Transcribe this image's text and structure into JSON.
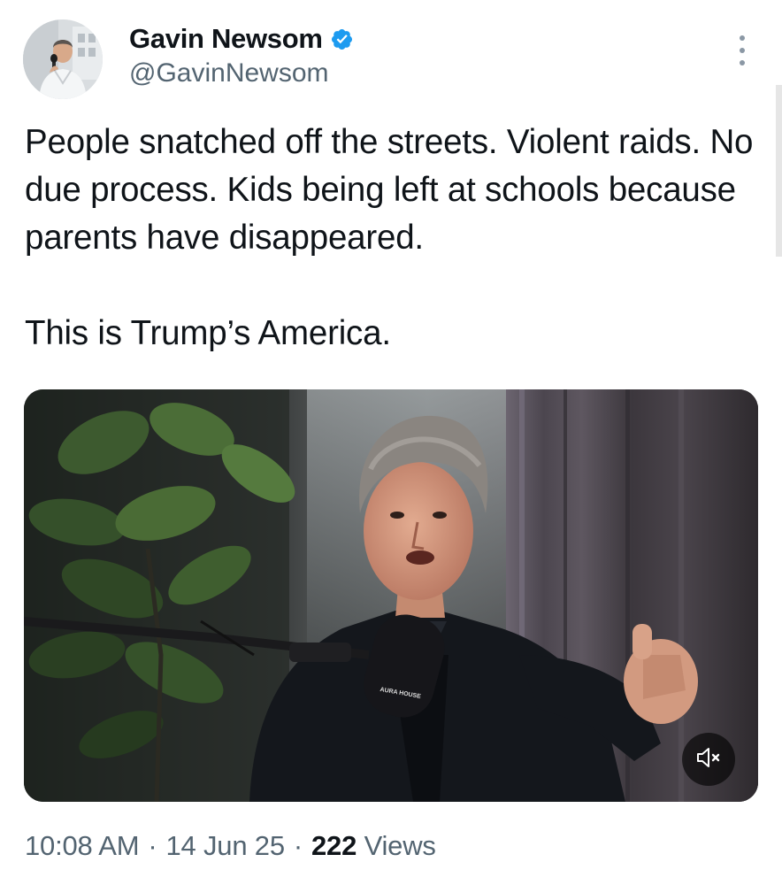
{
  "author": {
    "display_name": "Gavin Newsom",
    "handle": "@GavinNewsom",
    "verified": true,
    "verified_color": "#1d9bf0"
  },
  "tweet": {
    "paragraphs": [
      "People snatched off the streets. Violent raids. No due process. Kids being left at schools because parents have disappeared.",
      "This is Trump’s America."
    ]
  },
  "media": {
    "type": "video",
    "icon": "volume-muted-icon",
    "mic_brand": "AURA HOUSE"
  },
  "meta": {
    "time": "10:08 AM",
    "separator": "·",
    "date": "14 Jun 25",
    "views_count": "222",
    "views_label": "Views"
  },
  "colors": {
    "text_primary": "#0f1419",
    "text_secondary": "#536471",
    "accent": "#1d9bf0"
  }
}
